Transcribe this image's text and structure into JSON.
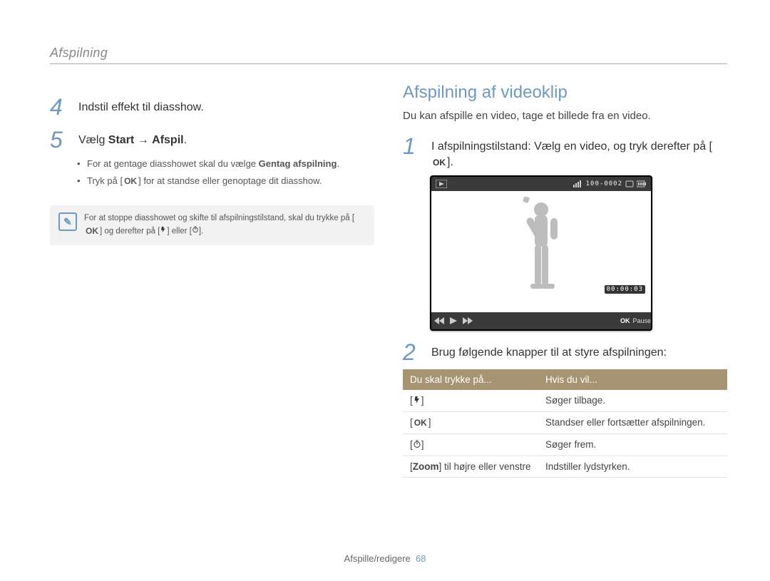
{
  "running_head": "Afspilning",
  "left": {
    "step4": {
      "num": "4",
      "text": "Indstil effekt til diasshow."
    },
    "step5": {
      "num": "5",
      "pre": "Vælg ",
      "b1": "Start",
      "arrow": " → ",
      "b2": "Afspil",
      "post": "."
    },
    "bullets": [
      {
        "pre": "For at gentage diasshowet skal du vælge ",
        "bold": "Gentag afspilning",
        "post": "."
      },
      {
        "pre": "Tryk på [",
        "mid": "] for at standse eller genoptage dit diasshow."
      }
    ],
    "note": "For at stoppe diasshowet og skifte til afspilningstilstand, skal du trykke på [",
    "note2": "] og derefter på [",
    "note3": "] eller [",
    "note4": "]."
  },
  "right": {
    "h2": "Afspilning af videoklip",
    "lede": "Du kan afspille en video, tage et billede fra en video.",
    "step1": {
      "num": "1",
      "text_a": "I afspilningstilstand: Vælg en video, og tryk derefter på [",
      "text_b": "]."
    },
    "cam": {
      "counter": "100-0002",
      "time": "00:00:03",
      "ok": "OK",
      "pause": "Pause"
    },
    "step2": {
      "num": "2",
      "text": "Brug følgende knapper til at styre afspilningen:"
    },
    "table": {
      "head": [
        "Du skal trykke på...",
        "Hvis du vil..."
      ],
      "rows": [
        {
          "key_icon": "flash",
          "action": "Søger tilbage."
        },
        {
          "key_icon": "ok",
          "action": "Standser eller fortsætter afspilningen."
        },
        {
          "key_icon": "timer",
          "action": "Søger frem."
        },
        {
          "key_label_a": "[",
          "key_bold": "Zoom",
          "key_label_b": "] til højre eller venstre",
          "action": "Indstiller lydstyrken."
        }
      ]
    }
  },
  "footer": {
    "section": "Afspille/redigere",
    "page": "68"
  }
}
